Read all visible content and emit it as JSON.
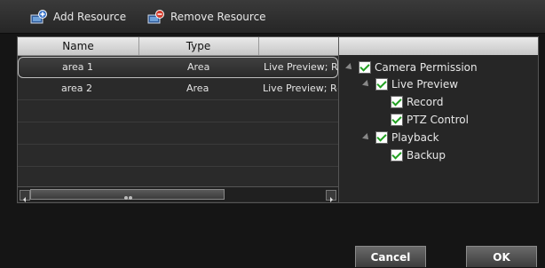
{
  "toolbar": {
    "add_label": "Add Resource",
    "remove_label": "Remove Resource"
  },
  "table": {
    "columns": [
      "Name",
      "Type"
    ],
    "rows": [
      {
        "name": "area 1",
        "type": "Area",
        "perm": "Live Preview; Re"
      },
      {
        "name": "area 2",
        "type": "Area",
        "perm": "Live Preview; Re"
      }
    ]
  },
  "tree": {
    "root": "Camera Permission",
    "live_preview": "Live Preview",
    "record": "Record",
    "ptz": "PTZ Control",
    "playback": "Playback",
    "backup": "Backup"
  },
  "footer": {
    "cancel_label": "Cancel",
    "ok_label": "OK"
  }
}
